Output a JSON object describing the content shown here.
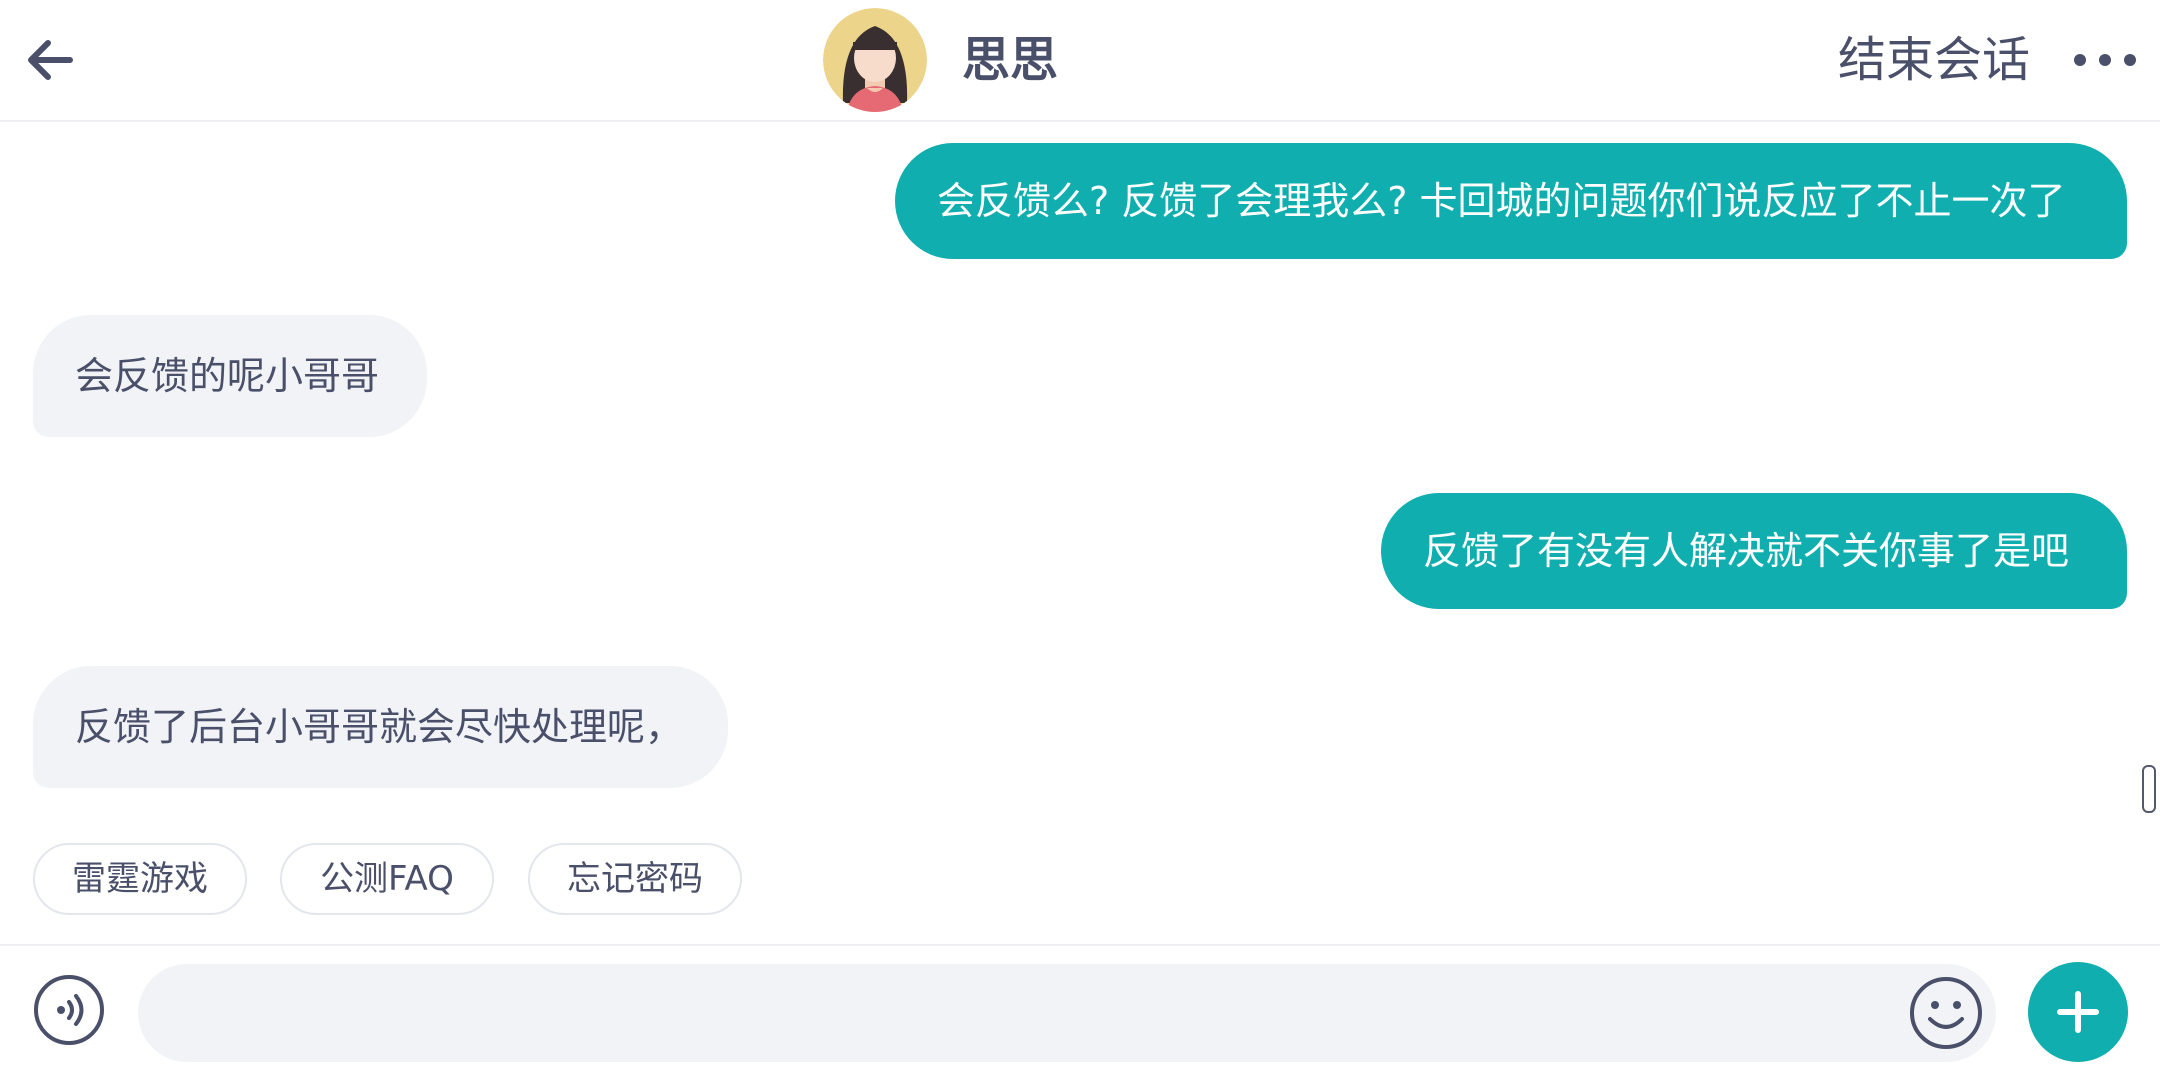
{
  "header": {
    "back_icon": "arrow-left-icon",
    "avatar_icon": "female-avatar-icon",
    "title": "思思",
    "end_session_label": "结束会话",
    "more_icon": "more-horizontal-icon"
  },
  "messages": [
    {
      "direction": "out",
      "text": "会反馈么? 反馈了会理我么? 卡回城的问题你们说反应了不止一次了"
    },
    {
      "direction": "in",
      "text": "会反馈的呢小哥哥"
    },
    {
      "direction": "out",
      "text": "反馈了有没有人解决就不关你事了是吧"
    },
    {
      "direction": "in",
      "text": "反馈了后台小哥哥就会尽快处理呢，"
    }
  ],
  "quick_replies": [
    "雷霆游戏",
    "公测FAQ",
    "忘记密码"
  ],
  "composer": {
    "voice_icon": "voice-icon",
    "input_value": "",
    "input_placeholder": "",
    "emoji_icon": "emoji-icon",
    "plus_icon": "plus-icon"
  },
  "colors": {
    "accent": "#10aeae",
    "incoming_bubble": "#f1f3f6",
    "text": "#4a4f6a"
  }
}
